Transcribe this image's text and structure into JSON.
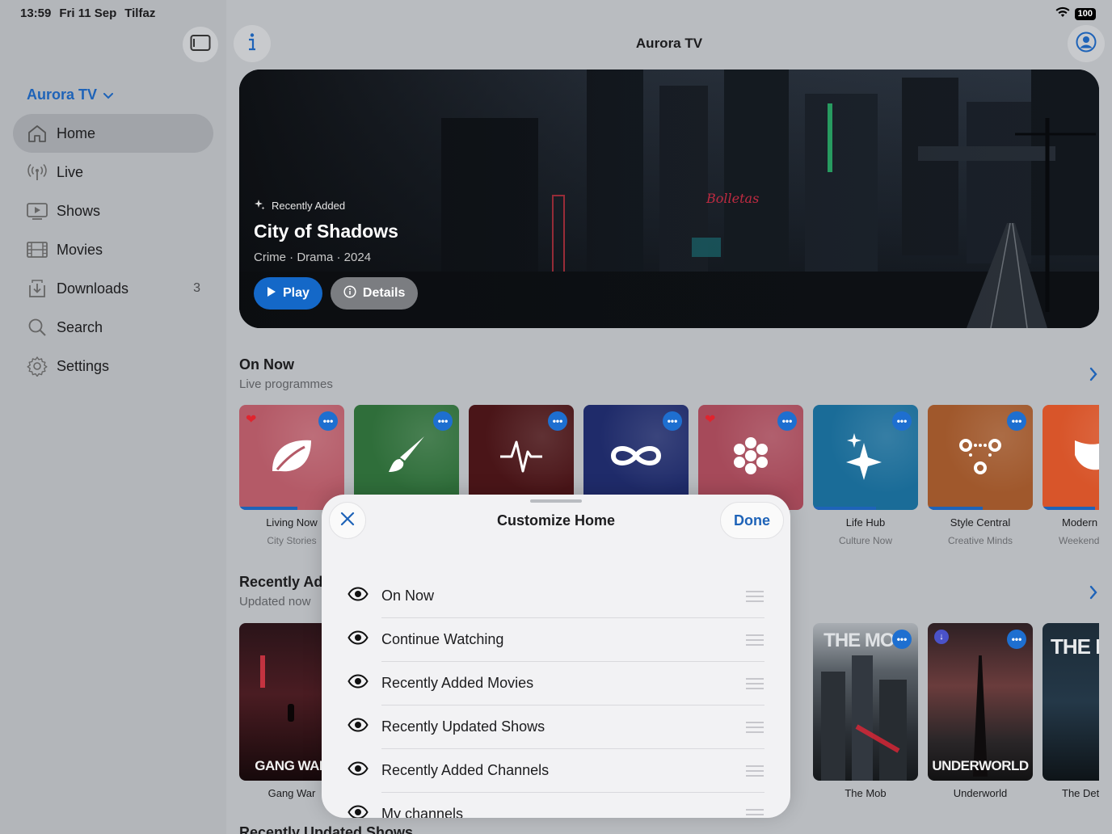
{
  "status": {
    "time": "13:59",
    "date": "Fri 11 Sep",
    "carrier": "Tilfaz",
    "battery": "100"
  },
  "sidebar": {
    "app_name": "Aurora TV",
    "items": [
      {
        "label": "Home",
        "icon": "house-icon",
        "active": true,
        "count": ""
      },
      {
        "label": "Live",
        "icon": "broadcast-icon",
        "active": false,
        "count": ""
      },
      {
        "label": "Shows",
        "icon": "tv-play-icon",
        "active": false,
        "count": ""
      },
      {
        "label": "Movies",
        "icon": "film-icon",
        "active": false,
        "count": ""
      },
      {
        "label": "Downloads",
        "icon": "download-tray-icon",
        "active": false,
        "count": "3"
      },
      {
        "label": "Search",
        "icon": "search-icon",
        "active": false,
        "count": ""
      },
      {
        "label": "Settings",
        "icon": "gear-icon",
        "active": false,
        "count": ""
      }
    ]
  },
  "header": {
    "title": "Aurora TV"
  },
  "hero": {
    "badge": "Recently Added",
    "title": "City of Shadows",
    "meta": "Crime · Drama · 2024",
    "play_label": "Play",
    "details_label": "Details"
  },
  "on_now": {
    "title": "On Now",
    "subtitle": "Live programmes",
    "channels": [
      {
        "name": "Living Now",
        "sub": "City Stories",
        "icon": "leaf-icon",
        "color": "#b45a67",
        "fav": true,
        "progress": 0.55
      },
      {
        "name": "",
        "sub": "",
        "icon": "paintbrush-icon",
        "color": "#2f6e3a",
        "fav": false,
        "progress": 0
      },
      {
        "name": "",
        "sub": "",
        "icon": "waveform-icon",
        "color": "#4a1518",
        "fav": false,
        "progress": 0
      },
      {
        "name": "",
        "sub": "",
        "icon": "infinity-icon",
        "color": "#1f2b6a",
        "fav": false,
        "progress": 0
      },
      {
        "name": "",
        "sub": "",
        "icon": "flower-icon",
        "color": "#a64a5a",
        "fav": true,
        "progress": 0
      },
      {
        "name": "Life Hub",
        "sub": "Culture Now",
        "icon": "sparkles-icon",
        "color": "#1a6c98",
        "fav": false,
        "progress": 0.6
      },
      {
        "name": "Style Central",
        "sub": "Creative Minds",
        "icon": "nodes-icon",
        "color": "#a0582c",
        "fav": false,
        "progress": 0.52
      },
      {
        "name": "Modern",
        "sub": "Weekend",
        "icon": "mask-icon",
        "color": "#d8552a",
        "fav": false,
        "progress": 0.5
      }
    ]
  },
  "recently_added": {
    "title": "Recently Added",
    "subtitle": "Updated now",
    "movies": [
      {
        "name": "Gang War",
        "art_text": "GANG WAR"
      },
      {
        "name": "The Mob",
        "art_text": "THE MOB"
      },
      {
        "name": "Underworld",
        "art_text": "UNDERWORLD"
      },
      {
        "name": "The Detective",
        "art_text": "THE DETEC"
      }
    ]
  },
  "next_section": {
    "title": "Recently Updated Shows"
  },
  "sheet": {
    "title": "Customize Home",
    "done_label": "Done",
    "rows": [
      {
        "label": "On Now"
      },
      {
        "label": "Continue Watching"
      },
      {
        "label": "Recently Added Movies"
      },
      {
        "label": "Recently Updated Shows"
      },
      {
        "label": "Recently Added Channels"
      },
      {
        "label": "My channels"
      }
    ]
  }
}
